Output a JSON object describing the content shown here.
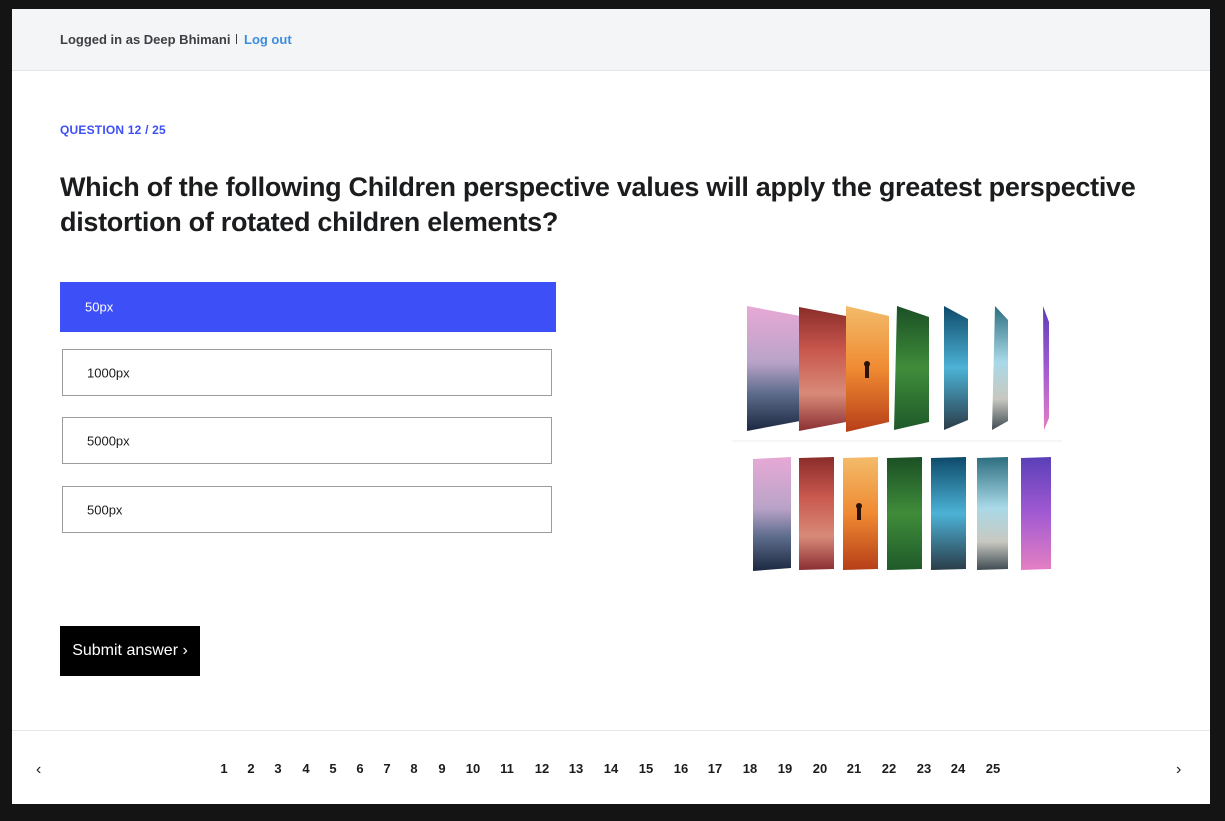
{
  "topbar": {
    "logged_in_text": "Logged in as Deep Bhimani",
    "logout_label": "Log out"
  },
  "question": {
    "counter": "QUESTION 12 / 25",
    "text": "Which of the following Children perspective values will apply the greatest perspective distortion of rotated children elements?"
  },
  "options": [
    {
      "label": "50px",
      "selected": true
    },
    {
      "label": "1000px",
      "selected": false
    },
    {
      "label": "5000px",
      "selected": false
    },
    {
      "label": "500px",
      "selected": false
    }
  ],
  "submit_label": "Submit answer ›",
  "pagination": {
    "prev_icon": "‹",
    "next_icon": "›",
    "pages": [
      "1",
      "2",
      "3",
      "4",
      "5",
      "6",
      "7",
      "8",
      "9",
      "10",
      "11",
      "12",
      "13",
      "14",
      "15",
      "16",
      "17",
      "18",
      "19",
      "20",
      "21",
      "22",
      "23",
      "24",
      "25"
    ]
  },
  "colors": {
    "accent": "#3d4ff7",
    "link": "#3a8ddf",
    "text": "#1b1c1e"
  }
}
